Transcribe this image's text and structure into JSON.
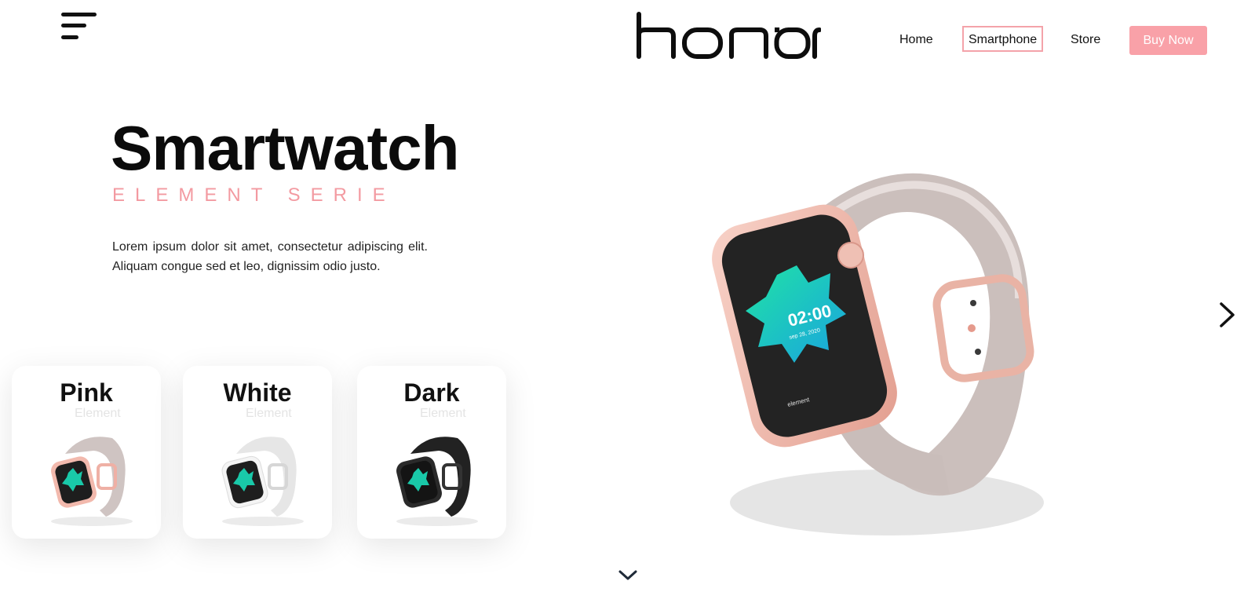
{
  "brand": {
    "logo_text": "honor"
  },
  "nav": {
    "items": [
      "Home",
      "Smartphone",
      "Store"
    ],
    "active": "Smartphone",
    "cta_label": "Buy Now"
  },
  "hero": {
    "title": "Smartwatch",
    "subtitle": "ELEMENT SERIE",
    "description": "Lorem ipsum dolor sit amet, consectetur adipiscing elit. Aliquam congue sed et leo, dignissim odio justo."
  },
  "watch_screen": {
    "time": "02:00",
    "date": "sep 28, 2020",
    "brand_mark": "element"
  },
  "variants": [
    {
      "name": "Pink",
      "tag": "Element",
      "case_color": "#f2b9ad",
      "band_color": "#cfc4c2"
    },
    {
      "name": "White",
      "tag": "Element",
      "case_color": "#f2f2f2",
      "band_color": "#e6e6e6"
    },
    {
      "name": "Dark",
      "tag": "Element",
      "case_color": "#1f1f1f",
      "band_color": "#222222"
    }
  ],
  "colors": {
    "accent": "#f9a1a8",
    "subtitle": "#f39aa1",
    "text": "#111111"
  },
  "icons": {
    "menu": "hamburger-menu-icon",
    "next": "chevron-right-icon",
    "scroll": "chevron-down-icon"
  }
}
